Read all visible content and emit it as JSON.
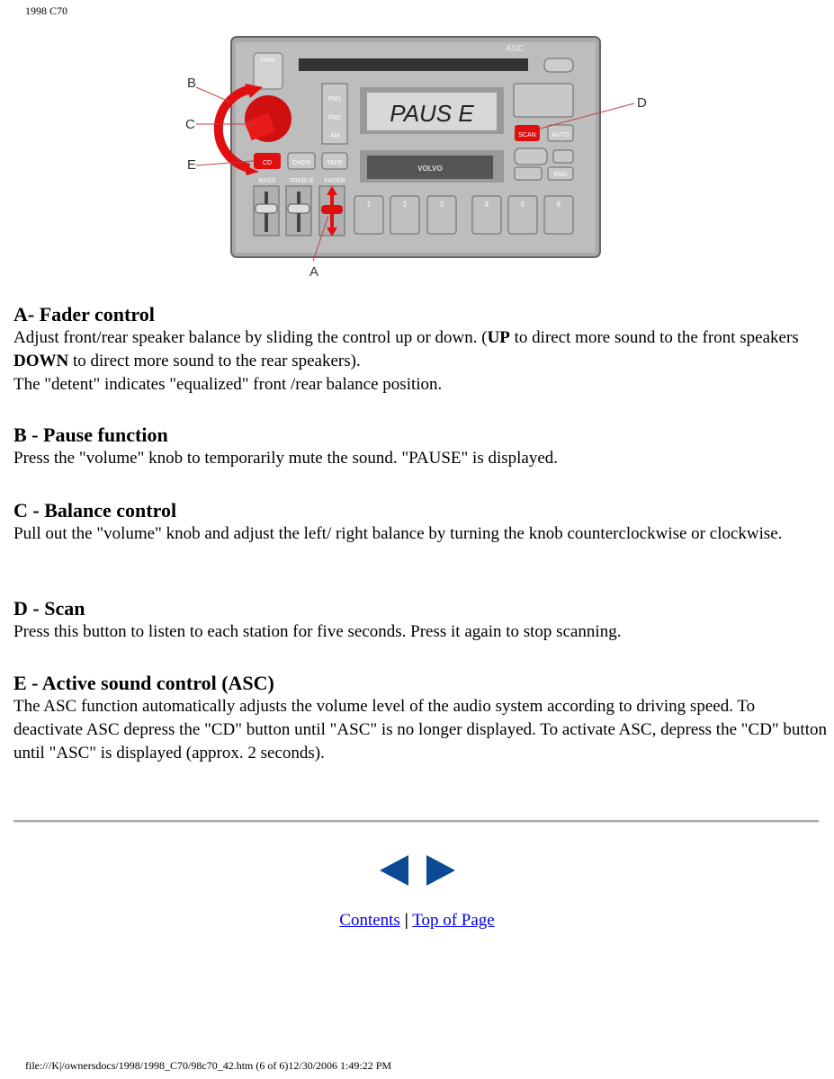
{
  "header": {
    "title": "1998 C70"
  },
  "figure": {
    "callouts": [
      "A",
      "B",
      "C",
      "D",
      "E"
    ],
    "display_text": "PAUS E",
    "buttons": {
      "pwr": "PWR",
      "fm1": "FM1",
      "fm2": "FM2",
      "am": "AM",
      "cd": "CD",
      "chgr": "CHGR",
      "tape": "TAPE",
      "scan": "SCAN",
      "auto": "AUTO",
      "rnd": "RND",
      "brand": "VOLVO"
    },
    "slider_labels": [
      "BASS",
      "TREBLE",
      "FADER"
    ],
    "presets": [
      "1",
      "2",
      "3",
      "4",
      "5",
      "6"
    ],
    "highlight_color": "#e01010"
  },
  "sections": [
    {
      "heading": "A- Fader control",
      "body_html": "Adjust front/rear speaker balance by sliding the control up or down. (<b>UP</b> to direct more sound to the front speakers <b>DOWN</b> to direct more sound to the rear speakers).<br>The \"detent\" indicates \"equalized\" front /rear balance position."
    },
    {
      "heading": "B - Pause function",
      "body": "Press the \"volume\" knob to temporarily mute the sound. \"PAUSE\" is displayed."
    },
    {
      "heading": "C - Balance control",
      "body": "Pull out the \"volume\" knob and adjust the left/ right balance by turning the knob counterclockwise or clockwise."
    },
    {
      "heading": "D - Scan",
      "body": "Press this button to listen to each station for five seconds. Press it again to stop scanning."
    },
    {
      "heading": "E - Active sound control (ASC)",
      "body": "The ASC function automatically adjusts the volume level of the audio system according to driving speed. To deactivate ASC depress the \"CD\" button until \"ASC\" is no longer displayed. To activate ASC, depress the \"CD\" button until \"ASC\" is displayed (approx. 2 seconds)."
    }
  ],
  "nav": {
    "prev": "previous-page",
    "next": "next-page",
    "color": "#0a4a94"
  },
  "links": {
    "contents": "Contents",
    "separator": "|",
    "top": "Top of Page"
  },
  "footer": "file:///K|/ownersdocs/1998/1998_C70/98c70_42.htm (6 of 6)12/30/2006 1:49:22 PM"
}
